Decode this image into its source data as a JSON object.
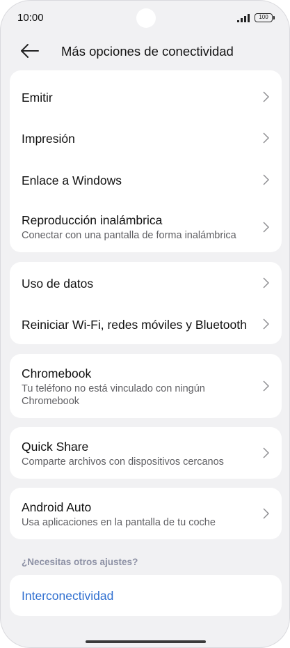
{
  "status_bar": {
    "time": "10:00",
    "battery": "100"
  },
  "header": {
    "title": "Más opciones de conectividad"
  },
  "group1": {
    "emitir": "Emitir",
    "impresion": "Impresión",
    "enlace_windows": "Enlace a Windows",
    "reproduccion_title": "Reproducción inalámbrica",
    "reproduccion_sub": "Conectar con una pantalla de forma inalámbrica"
  },
  "group2": {
    "uso_datos": "Uso de datos",
    "reiniciar": "Reiniciar Wi-Fi, redes móviles y Bluetooth"
  },
  "chromebook": {
    "title": "Chromebook",
    "sub": "Tu teléfono no está vinculado con ningún Chromebook"
  },
  "quick_share": {
    "title": "Quick Share",
    "sub": "Comparte archivos con dispositivos cercanos"
  },
  "android_auto": {
    "title": "Android Auto",
    "sub": "Usa aplicaciones en la pantalla de tu coche"
  },
  "other_settings": {
    "label": "¿Necesitas otros ajustes?",
    "link": "Interconectividad"
  },
  "colors": {
    "accent": "#2f6fd0",
    "background": "#f1f1f3",
    "card": "#ffffff",
    "section_label": "#8c90a4"
  },
  "icons": [
    "back-arrow-icon",
    "chevron-right-icon",
    "signal-icon",
    "battery-icon"
  ]
}
